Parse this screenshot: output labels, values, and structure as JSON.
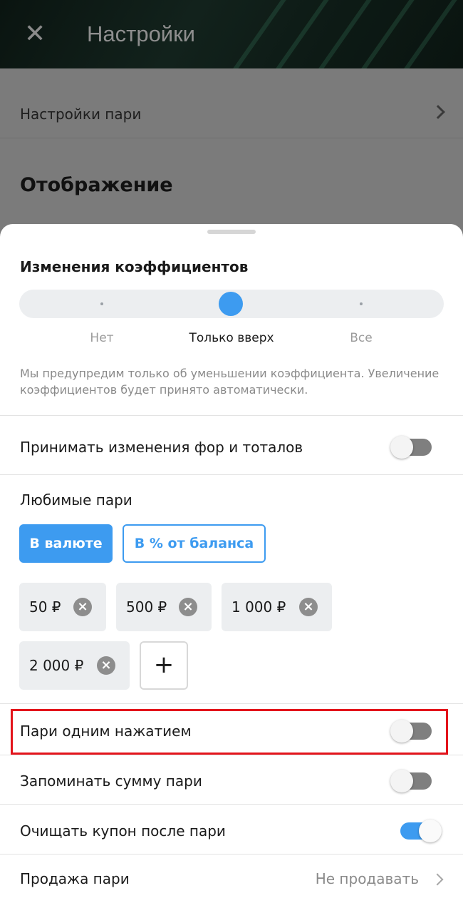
{
  "background": {
    "title": "Настройки",
    "rows": [
      {
        "label": "Настройки пари"
      }
    ],
    "section_title": "Отображение"
  },
  "sheet": {
    "odds_title": "Изменения коэффициентов",
    "odds_options": [
      "Нет",
      "Только вверх",
      "Все"
    ],
    "odds_selected": "Только вверх",
    "odds_hint": "Мы предупредим только об уменьшении коэффициента. Увеличение коэффициентов будет принято автоматически.",
    "accept_handicap_label": "Принимать изменения фор и тоталов",
    "accept_handicap_on": false,
    "favorite_title": "Любимые пари",
    "mode_currency": "В валюте",
    "mode_percent": "В % от баланса",
    "amounts": [
      "50 ₽",
      "500 ₽",
      "1 000 ₽",
      "2 000 ₽"
    ],
    "add_label": "+",
    "one_click_label": "Пари одним нажатием",
    "one_click_on": false,
    "remember_sum_label": "Запоминать сумму пари",
    "remember_sum_on": false,
    "clear_coupon_label": "Очищать купон после пари",
    "clear_coupon_on": true,
    "sell_label": "Продажа пари",
    "sell_value": "Не продавать"
  },
  "colors": {
    "accent": "#3d9bf0",
    "highlight": "#e3141b"
  }
}
